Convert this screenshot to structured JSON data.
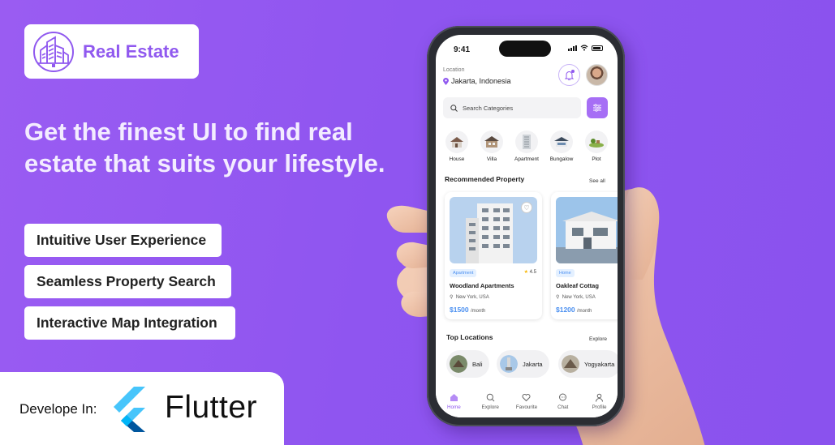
{
  "brand": {
    "name": "Real Estate"
  },
  "headline": "Get the finest UI to find real estate that suits your lifestyle.",
  "features": [
    "Intuitive User Experience",
    "Seamless Property Search",
    "Interactive Map Integration"
  ],
  "developed": {
    "label": "Develope In:",
    "framework": "Flutter"
  },
  "phone": {
    "status": {
      "time": "9:41"
    },
    "location": {
      "label": "Location",
      "value": "Jakarta, Indonesia"
    },
    "search": {
      "placeholder": "Search Categories"
    },
    "categories": [
      {
        "label": "House",
        "icon": "house-icon"
      },
      {
        "label": "Villa",
        "icon": "villa-icon"
      },
      {
        "label": "Apartment",
        "icon": "apartment-icon"
      },
      {
        "label": "Bungalow",
        "icon": "bungalow-icon"
      },
      {
        "label": "Plot",
        "icon": "plot-icon"
      }
    ],
    "recommended": {
      "title": "Recommended Property",
      "see_all": "See all",
      "cards": [
        {
          "tag": "Apartment",
          "rating": "4.5",
          "name": "Woodland Apartments",
          "location": "New York, USA",
          "price": "$1500",
          "period": "/month"
        },
        {
          "tag": "Home",
          "name": "Oakleaf Cottag",
          "location": "New York, USA",
          "price": "$1200",
          "period": "/month"
        }
      ]
    },
    "top_locations": {
      "title": "Top Locations",
      "explore": "Explore",
      "items": [
        "Bali",
        "Jakarta",
        "Yogyakarta"
      ]
    },
    "tabs": [
      {
        "label": "Home",
        "icon": "home-icon",
        "active": true
      },
      {
        "label": "Explore",
        "icon": "search-icon"
      },
      {
        "label": "Favourite",
        "icon": "heart-icon"
      },
      {
        "label": "Chat",
        "icon": "chat-icon"
      },
      {
        "label": "Profile",
        "icon": "person-icon"
      }
    ]
  },
  "colors": {
    "background": "#9059ef",
    "accent": "#9059ef",
    "price": "#4a8ff0"
  }
}
